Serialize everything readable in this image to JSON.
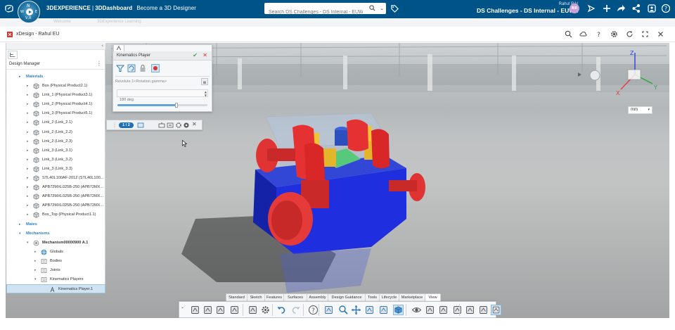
{
  "topbar": {
    "compass": {
      "north": "N",
      "west": "W",
      "east": "E",
      "vr": "V,R"
    },
    "brand": "3DEXPERIENCE",
    "separator": "|",
    "app": "3DDashboard",
    "dashboard": "Become a 3D Designer",
    "search_placeholder": "Search DS Challenges - DS Internal - EUW1",
    "user_name": "Rahul RAI",
    "tenant": "DS Challenges - DS Internal - EUW1",
    "avatar_initials": "RR",
    "colors": {
      "bar": "#005386",
      "avatar": "#c9a0d8"
    }
  },
  "subbar": {
    "left": "Welcome",
    "right": "3DExperience Learning"
  },
  "app_header": {
    "title": "xDesign - Rahul EU"
  },
  "tree": {
    "title": "Design Manager",
    "rows": [
      {
        "label": "Materials",
        "type": "category",
        "indent": 0,
        "expander": "▸"
      },
      {
        "label": "Box (Physical Product2.1)",
        "indent": 1,
        "expander": "▸",
        "icon": "product"
      },
      {
        "label": "Link_1 (Physical Product3.1)",
        "indent": 1,
        "expander": "▸",
        "icon": "product"
      },
      {
        "label": "Link_2 (Physical Product4.1)",
        "indent": 1,
        "expander": "▸",
        "icon": "product"
      },
      {
        "label": "Link_3 (Physical Product5.1)",
        "indent": 1,
        "expander": "▸",
        "icon": "product"
      },
      {
        "label": "Link_2 (Link_2.1)",
        "indent": 1,
        "expander": "▸",
        "icon": "product"
      },
      {
        "label": "Link_2 (Link_2.2)",
        "indent": 1,
        "expander": "▸",
        "icon": "product"
      },
      {
        "label": "Link_2 (Link_2.3)",
        "indent": 1,
        "expander": "▸",
        "icon": "product"
      },
      {
        "label": "Link_3 (Link_3.1)",
        "indent": 1,
        "expander": "▸",
        "icon": "product"
      },
      {
        "label": "Link_3 (Link_3.2)",
        "indent": 1,
        "expander": "▸",
        "icon": "product"
      },
      {
        "label": "Link_3 (Link_3.3)",
        "indent": 1,
        "expander": "▸",
        "icon": "product"
      },
      {
        "label": "STL40L100AF-2012 (STL40L100...",
        "indent": 1,
        "expander": "▸",
        "icon": "product"
      },
      {
        "label": "APB72MXL025B-250 (APB72MX...",
        "indent": 1,
        "expander": "▸",
        "icon": "product"
      },
      {
        "label": "APB72MXL025B-250 (APB72MX...",
        "indent": 1,
        "expander": "▸",
        "icon": "product"
      },
      {
        "label": "APB72MXL025B-250 (APB72MX...",
        "indent": 1,
        "expander": "▸",
        "icon": "product"
      },
      {
        "label": "Box_Top (Physical Product1.1)",
        "indent": 1,
        "expander": "▸",
        "icon": "product"
      },
      {
        "label": "Mates",
        "type": "category",
        "indent": 0,
        "expander": "▸"
      },
      {
        "label": "Mechanisms",
        "type": "category",
        "indent": 0,
        "expander": "▾"
      },
      {
        "label": "Mechanism00000900 A.1",
        "type": "bold",
        "indent": 1,
        "expander": "▾",
        "icon": "mechanism"
      },
      {
        "label": "Globals",
        "indent": 2,
        "expander": "▸",
        "icon": "globe"
      },
      {
        "label": "Bodies",
        "indent": 2,
        "expander": "▸",
        "icon": "folder"
      },
      {
        "label": "Joints",
        "indent": 2,
        "expander": "▸",
        "icon": "folder"
      },
      {
        "label": "Kinematics Players",
        "indent": 2,
        "expander": "▾",
        "icon": "folder"
      },
      {
        "label": "Kinematics Player.1",
        "indent": 3,
        "expander": "",
        "icon": "player",
        "selected": true
      }
    ]
  },
  "kinematics_player": {
    "title": "Kinematics Player",
    "ok_icon": "check-icon",
    "cancel_icon": "close-icon",
    "joint": "Revolute.1<Rotation gamma>",
    "value": "180 deg",
    "slider_fraction": 0.66
  },
  "player_toolbar": {
    "pages": "1 / 2"
  },
  "units": {
    "selected": "mm"
  },
  "axes": {
    "x": "X",
    "y": "Y",
    "z": "Z"
  },
  "bottom_tabs": [
    "Standard",
    "Sketch",
    "Features",
    "Surfaces",
    "Assembly",
    "Design Guidance",
    "Tools",
    "Lifecycle",
    "Marketplace",
    "View"
  ],
  "active_tab": "View"
}
